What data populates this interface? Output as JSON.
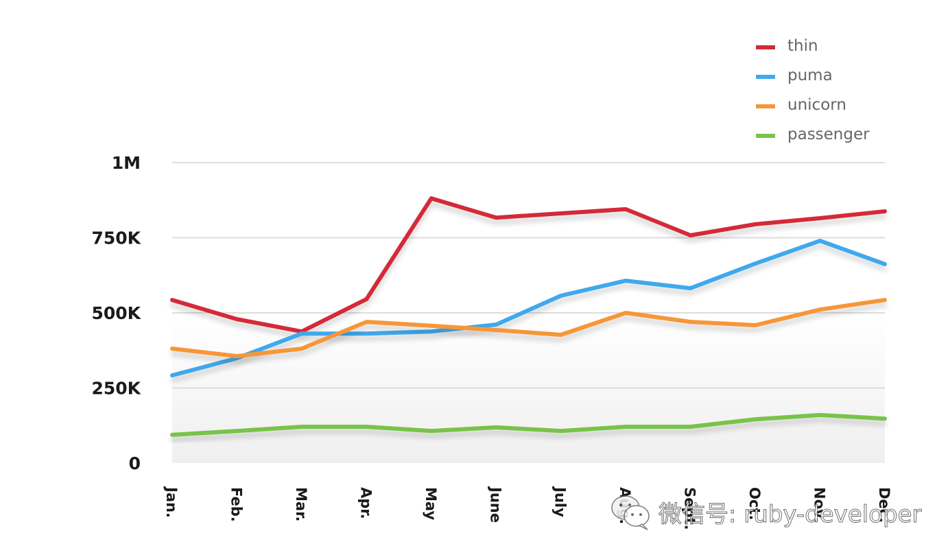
{
  "chart_data": {
    "type": "line",
    "title": "",
    "xlabel": "",
    "ylabel": "",
    "categories": [
      "Jan.",
      "Feb.",
      "Mar.",
      "Apr.",
      "May",
      "June",
      "July",
      "Aug.",
      "Sept.",
      "Oct.",
      "Nov.",
      "Dec."
    ],
    "ylim": [
      0,
      1000000
    ],
    "yticks": [
      0,
      250000,
      500000,
      750000,
      1000000
    ],
    "ytick_labels": [
      "0",
      "250K",
      "500K",
      "750K",
      "1M"
    ],
    "grid": true,
    "legend_position": "top-right",
    "series": [
      {
        "name": "thin",
        "color": "#d42a38",
        "values": [
          543000,
          479000,
          438000,
          546000,
          881000,
          817000,
          831000,
          845000,
          758000,
          795000,
          815000,
          838000
        ]
      },
      {
        "name": "puma",
        "color": "#41a8ec",
        "values": [
          292000,
          349000,
          431000,
          431000,
          438000,
          461000,
          557000,
          607000,
          582000,
          664000,
          740000,
          662000
        ]
      },
      {
        "name": "unicorn",
        "color": "#f79637",
        "values": [
          381000,
          356000,
          381000,
          470000,
          457000,
          443000,
          427000,
          500000,
          470000,
          459000,
          511000,
          543000
        ]
      },
      {
        "name": "passenger",
        "color": "#78c34a",
        "values": [
          94000,
          107000,
          121000,
          121000,
          107000,
          119000,
          107000,
          121000,
          121000,
          146000,
          160000,
          148000
        ]
      }
    ]
  },
  "watermark": {
    "text": "微信号: ruby-developer",
    "icon": "wechat-icon"
  }
}
